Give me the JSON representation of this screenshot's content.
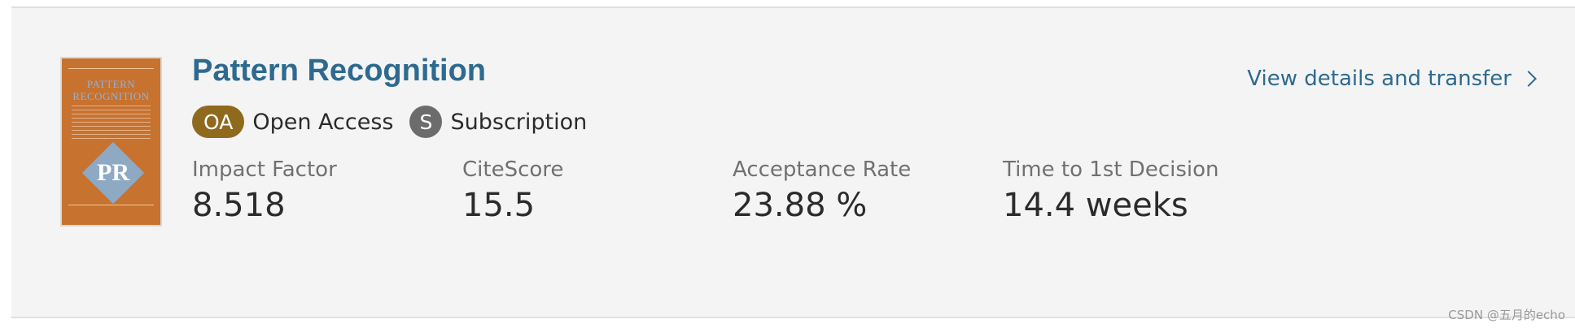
{
  "journal": {
    "title": "Pattern Recognition",
    "cover": {
      "title_line1": "PATTERN",
      "title_line2": "RECOGNITION",
      "logo": "PR",
      "colors": {
        "background": "#c7722f",
        "accent": "#8ea9c4"
      }
    }
  },
  "link": {
    "label": "View details and transfer"
  },
  "access": {
    "oa_badge": "OA",
    "oa_label": "Open Access",
    "sub_badge": "S",
    "sub_label": "Subscription"
  },
  "metrics": [
    {
      "label": "Impact Factor",
      "value": "8.518"
    },
    {
      "label": "CiteScore",
      "value": "15.5"
    },
    {
      "label": "Acceptance Rate",
      "value": "23.88 %"
    },
    {
      "label": "Time to 1st Decision",
      "value": "14.4 weeks"
    }
  ],
  "watermark": "CSDN @五月的echo",
  "colors": {
    "title": "#2e6a8f",
    "oa_badge": "#8f6a1e",
    "sub_badge": "#6c6c6c",
    "card_bg": "#f4f4f4"
  }
}
